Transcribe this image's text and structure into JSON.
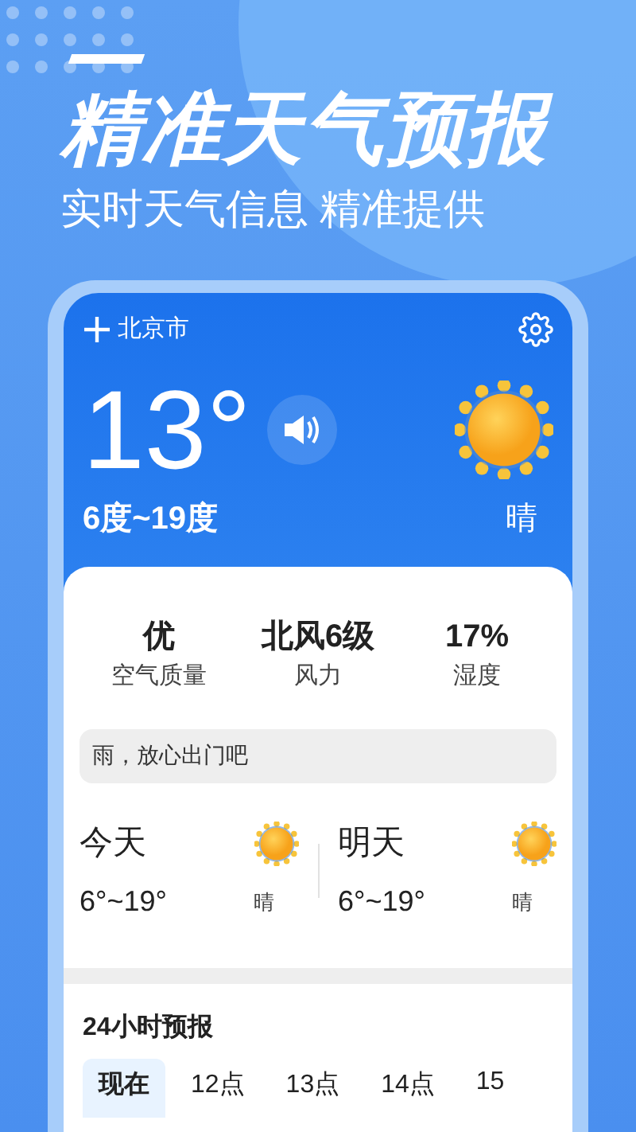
{
  "header": {
    "title": "精准天气预报",
    "subtitle": "实时天气信息 精准提供"
  },
  "location": {
    "city": "北京市"
  },
  "current": {
    "temperature": "13°",
    "range": "6度~19度",
    "condition": "晴"
  },
  "stats": [
    {
      "value": "优",
      "label": "空气质量"
    },
    {
      "value": "北风6级",
      "label": "风力"
    },
    {
      "value": "17%",
      "label": "湿度"
    }
  ],
  "tip": "雨，放心出门吧",
  "days": [
    {
      "name": "今天",
      "range": "6°~19°",
      "condition": "晴"
    },
    {
      "name": "明天",
      "range": "6°~19°",
      "condition": "晴"
    }
  ],
  "hourly": {
    "title": "24小时预报",
    "hours": [
      {
        "label": "现在",
        "selected": true
      },
      {
        "label": "12点",
        "selected": false
      },
      {
        "label": "13点",
        "selected": false
      },
      {
        "label": "14点",
        "selected": false
      },
      {
        "label": "15",
        "selected": false
      }
    ]
  }
}
